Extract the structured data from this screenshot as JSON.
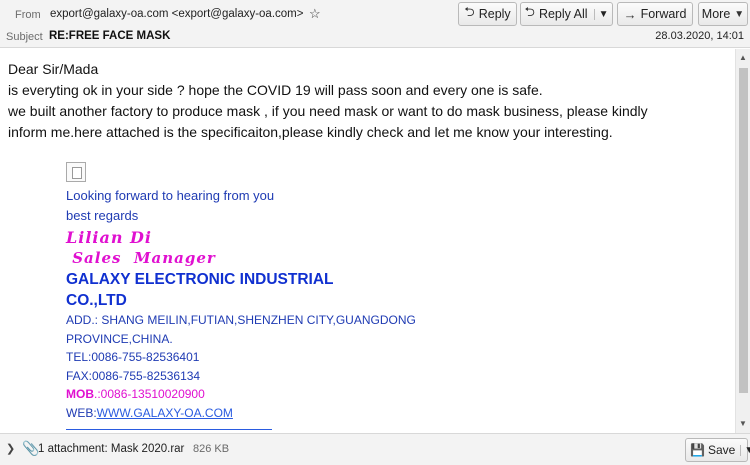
{
  "header": {
    "from_label": "From",
    "from_value": "export@galaxy-oa.com <export@galaxy-oa.com>",
    "star_icon": "☆",
    "subject_label": "Subject",
    "subject_value": "RE:FREE FACE MASK",
    "date": "28.03.2020, 14:01"
  },
  "toolbar": {
    "reply_label": "Reply",
    "reply_all_label": "Reply All",
    "forward_label": "Forward",
    "more_label": "More"
  },
  "body": {
    "greeting": "Dear Sir/Mada",
    "line1": "is everyting ok in your side ? hope the COVID 19 will pass soon and every one is safe.",
    "line2": "we built another  factory to produce mask , if you need mask or want to do mask business, please kindly",
    "line3": "inform me.here attached is the specificaiton,please kindly check and let me know your interesting."
  },
  "signature": {
    "looking": "Looking forward to hearing from you",
    "regards": "best regards",
    "name": "Lilian Di",
    "title": " Sales  Manager",
    "company1": "GALAXY ELECTRONIC INDUSTRIAL",
    "company2": "CO.,LTD",
    "addr1": "ADD.: SHANG MEILIN,FUTIAN,SHENZHEN CITY,GUANGDONG",
    "addr2": "PROVINCE,CHINA.",
    "tel": "TEL:0086-755-82536401",
    "fax": "FAX:0086-755-82536134",
    "mob_label": "MOB",
    "mob_value": ".:0086-13510020900",
    "web_label": "WEB:",
    "web_link": "WWW.GALAXY-OA.COM"
  },
  "footer": {
    "attachment_text": "1 attachment: Mask 2020.rar",
    "attachment_size": "826 KB",
    "save_label": "Save"
  }
}
